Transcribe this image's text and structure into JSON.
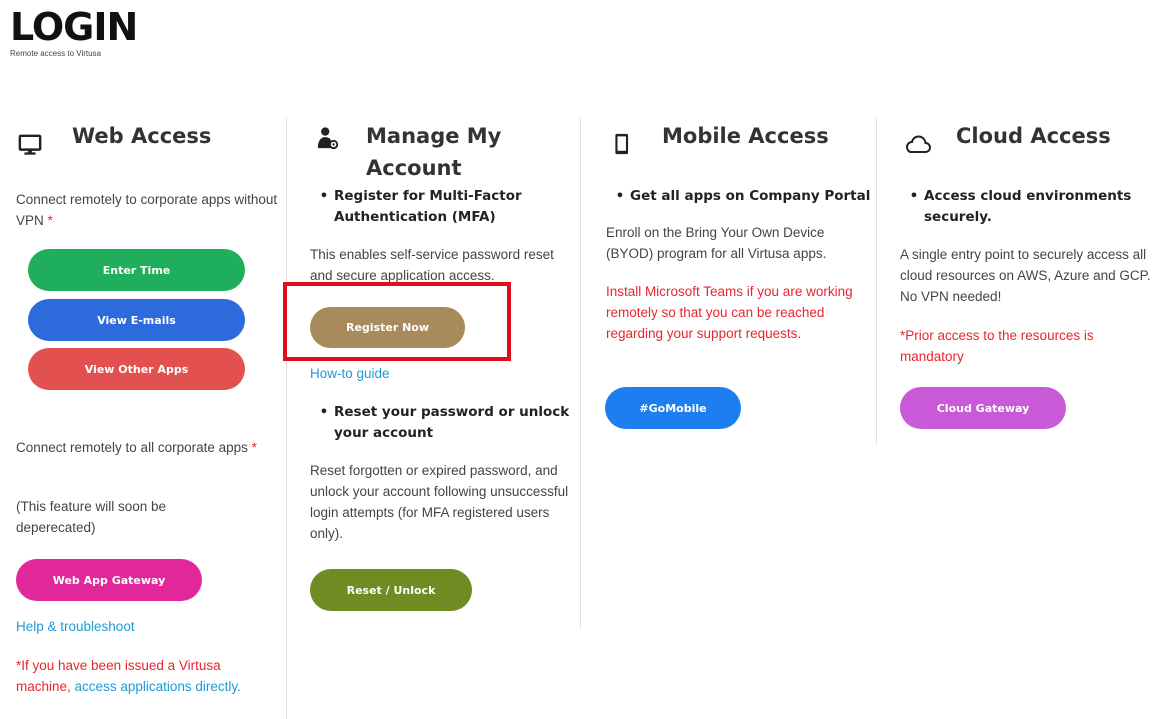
{
  "logo": {
    "text": "LOGIN",
    "subtitle": "Remote access to Virtusa"
  },
  "web_access": {
    "title": "Web Access",
    "icon": "monitor-icon",
    "desc": "Connect remotely to corporate apps without VPN",
    "asterisk": "*",
    "buttons": {
      "enter_time": "Enter Time",
      "view_emails": "View E-mails",
      "view_other_apps": "View Other Apps"
    },
    "desc2": "Connect remotely to all corporate apps",
    "asterisk2": "*",
    "note": "(This feature will soon be deperecated)",
    "gateway_button": "Web App Gateway",
    "help_link": "Help & troubleshoot",
    "issued_note_start": "*If you have been issued a Virtusa machine,",
    "issued_link": "access applications directly."
  },
  "manage_account": {
    "title": "Manage My Account",
    "icon": "user-gear-icon",
    "bullet1": "Register for Multi-Factor Authentication (MFA)",
    "desc1": "This enables self-service password reset and secure application access.",
    "register_button": "Register Now",
    "howto_link": "How-to guide",
    "bullet2": "Reset your password or unlock your account",
    "desc2": "Reset forgotten or expired password, and unlock your account following unsuccessful login attempts (for MFA registered users only).",
    "reset_button": "Reset / Unlock"
  },
  "mobile_access": {
    "title": "Mobile Access",
    "icon": "phone-icon",
    "bullet": "Get all apps on Company Portal",
    "desc": "Enroll on the Bring Your Own Device (BYOD) program for all Virtusa apps.",
    "teams_note": "Install Microsoft Teams if you are working remotely so that you can be reached regarding your support requests.",
    "button": "#GoMobile"
  },
  "cloud_access": {
    "title": "Cloud Access",
    "icon": "cloud-icon",
    "bullet": "Access cloud environments securely.",
    "desc": "A single entry point to securely access all cloud resources on AWS, Azure and GCP. No VPN needed!",
    "note": "*Prior access to the resources is mandatory",
    "button": "Cloud Gateway"
  },
  "colors": {
    "enter_time": "#1fae5b",
    "view_emails": "#2d6bdc",
    "view_other_apps": "#e2504f",
    "web_app_gateway": "#e0289a",
    "register_now": "#a88a5c",
    "reset_unlock": "#6e8c22",
    "go_mobile": "#1e7ef0",
    "cloud_gateway": "#c85ad8",
    "highlight": "#e00d1e",
    "red_text": "#e8262e",
    "link": "#1e9bd7"
  }
}
